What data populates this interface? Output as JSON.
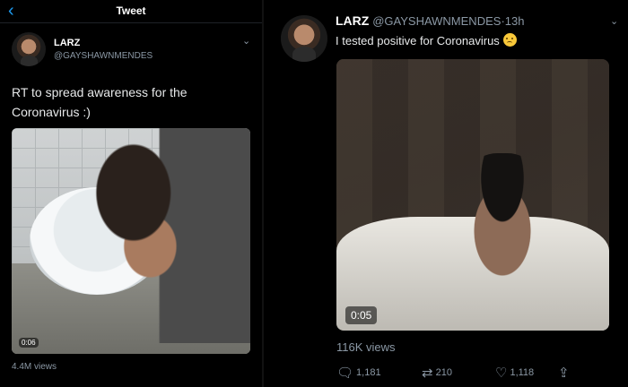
{
  "left": {
    "topbar": {
      "back_icon": "chevron-left-icon",
      "title": "Tweet"
    },
    "tweet": {
      "author_name": "LARZ",
      "author_handle": "@GAYSHAWNMENDES",
      "text": "RT to spread awareness for the Coronavirus :)",
      "video_time": "0:06",
      "views": "4.4M views"
    }
  },
  "right": {
    "tweet": {
      "author_name": "LARZ",
      "author_handle": "@GAYSHAWNMENDES",
      "separator": "·",
      "time": "13h",
      "text": "I tested positive for Coronavirus",
      "emoji": "worried-face-emoji",
      "video_time": "0:05",
      "views": "116K views"
    },
    "actions": {
      "reply_count": "1,181",
      "retweet_count": "210",
      "like_count": "1,118"
    }
  },
  "colors": {
    "accent": "#1d9bf0",
    "muted": "#8b98a5",
    "background": "#000000"
  }
}
